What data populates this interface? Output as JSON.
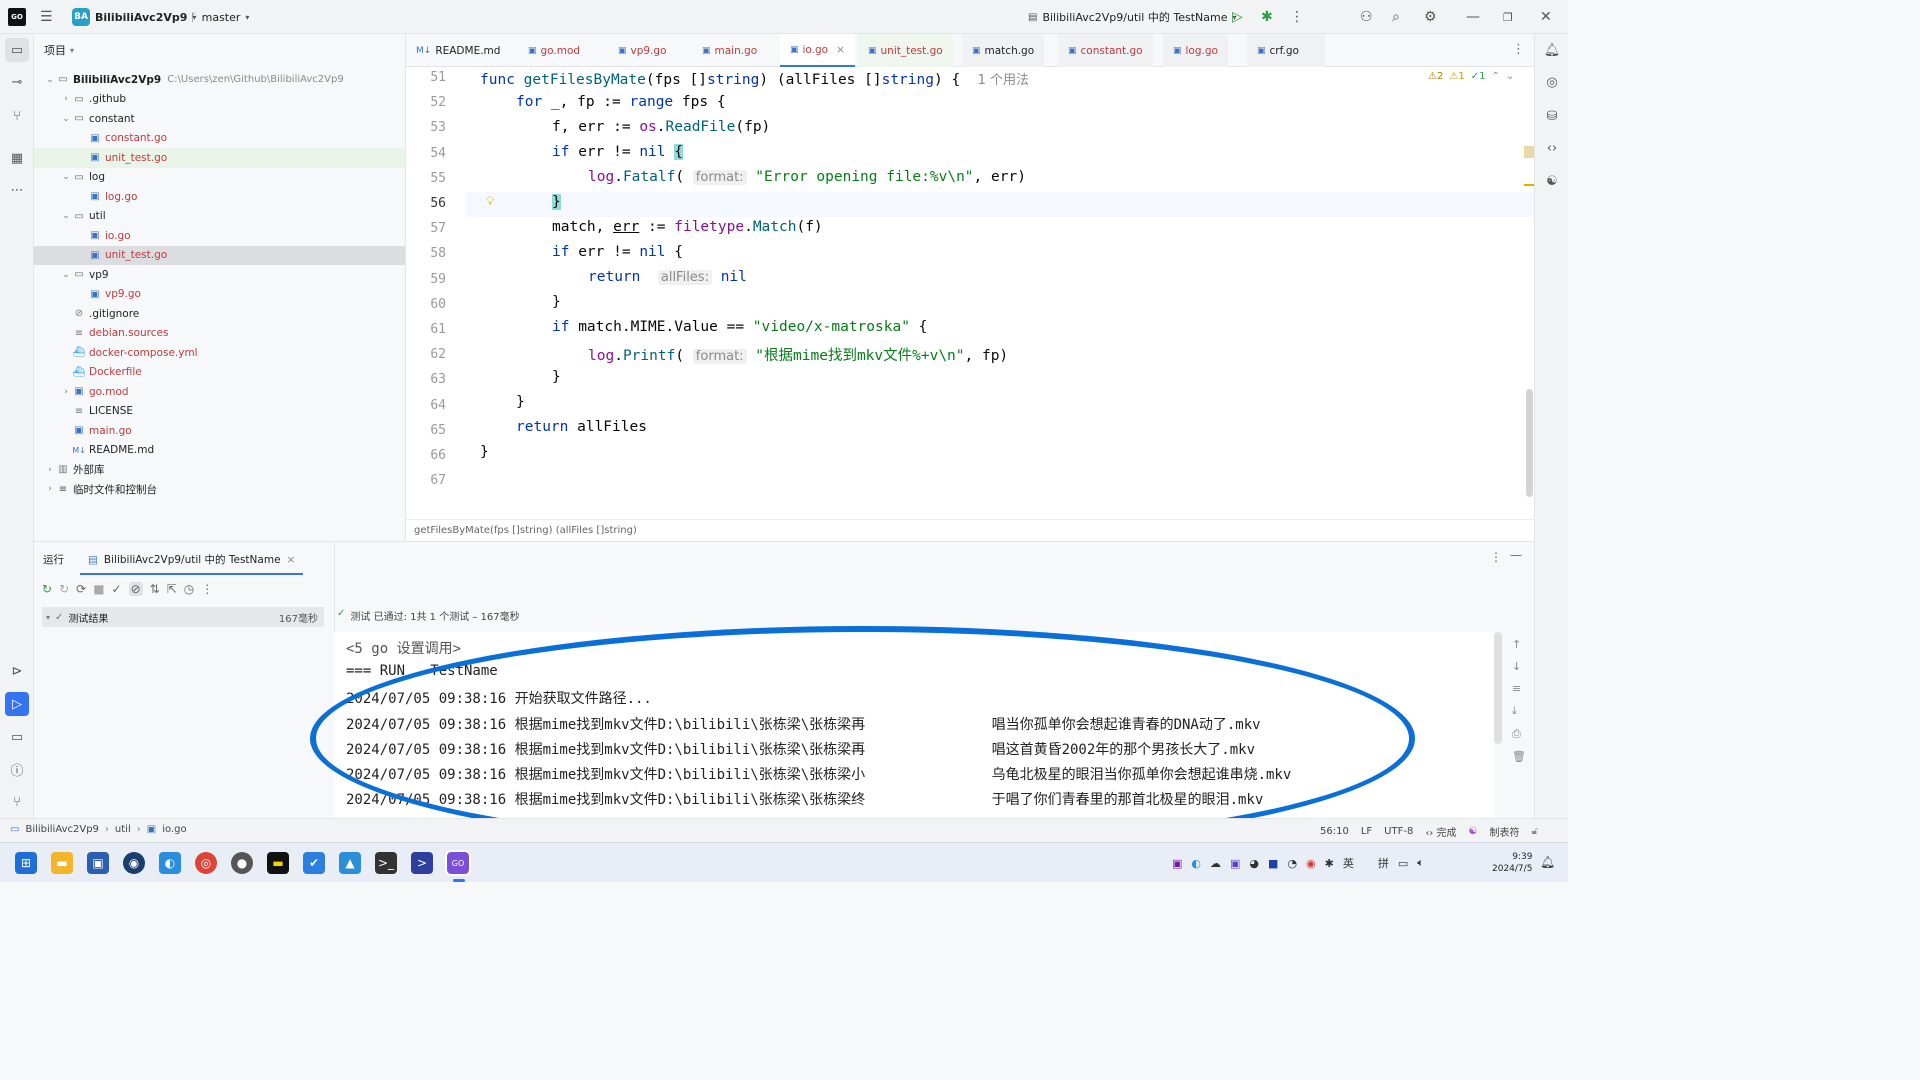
{
  "titlebar": {
    "logo": "GO",
    "project_badge": "BA",
    "project_name": "BilibiliAvc2Vp9",
    "branch": "master",
    "run_config": "BilibiliAvc2Vp9/util 中的 TestName"
  },
  "project_panel": {
    "title": "项目",
    "tree": [
      {
        "label": "BilibiliAvc2Vp9",
        "hint": "C:\\Users\\zen\\Github\\BilibiliAvc2Vp9",
        "depth": 0,
        "kind": "root",
        "expanded": true
      },
      {
        "label": ".github",
        "depth": 1,
        "kind": "folder",
        "expanded": false
      },
      {
        "label": "constant",
        "depth": 1,
        "kind": "folder",
        "expanded": true
      },
      {
        "label": "constant.go",
        "depth": 2,
        "kind": "go-red"
      },
      {
        "label": "unit_test.go",
        "depth": 2,
        "kind": "go-red",
        "highlight": "green"
      },
      {
        "label": "log",
        "depth": 1,
        "kind": "folder",
        "expanded": true
      },
      {
        "label": "log.go",
        "depth": 2,
        "kind": "go-red"
      },
      {
        "label": "util",
        "depth": 1,
        "kind": "folder",
        "expanded": true
      },
      {
        "label": "io.go",
        "depth": 2,
        "kind": "go-red"
      },
      {
        "label": "unit_test.go",
        "depth": 2,
        "kind": "go-red",
        "highlight": "selected"
      },
      {
        "label": "vp9",
        "depth": 1,
        "kind": "folder",
        "expanded": true
      },
      {
        "label": "vp9.go",
        "depth": 2,
        "kind": "go-red"
      },
      {
        "label": ".gitignore",
        "depth": 1,
        "kind": "ignore"
      },
      {
        "label": "debian.sources",
        "depth": 1,
        "kind": "text-red"
      },
      {
        "label": "docker-compose.yml",
        "depth": 1,
        "kind": "docker-red"
      },
      {
        "label": "Dockerfile",
        "depth": 1,
        "kind": "docker-red"
      },
      {
        "label": "go.mod",
        "depth": 1,
        "kind": "gomod-red",
        "collapsible": true
      },
      {
        "label": "LICENSE",
        "depth": 1,
        "kind": "text"
      },
      {
        "label": "main.go",
        "depth": 1,
        "kind": "go-red"
      },
      {
        "label": "README.md",
        "depth": 1,
        "kind": "md"
      },
      {
        "label": "外部库",
        "depth": 0,
        "kind": "lib",
        "collapsible": true
      },
      {
        "label": "临时文件和控制台",
        "depth": 0,
        "kind": "scratch",
        "collapsible": true
      }
    ]
  },
  "editor": {
    "tabs": [
      {
        "label": "README.md",
        "icon": "M↓"
      },
      {
        "label": "go.mod"
      },
      {
        "label": "vp9.go"
      },
      {
        "label": "main.go"
      },
      {
        "label": "io.go",
        "active": true
      },
      {
        "label": "unit_test.go"
      },
      {
        "label": "match.go"
      },
      {
        "label": "constant.go"
      },
      {
        "label": "log.go"
      },
      {
        "label": "crf.go"
      }
    ],
    "usage_hint": "1 个用法",
    "inspection": {
      "warn": "2",
      "weak": "1",
      "ok": "1"
    },
    "line_numbers": [
      "51",
      "52",
      "53",
      "54",
      "55",
      "56",
      "57",
      "58",
      "59",
      "60",
      "61",
      "62",
      "63",
      "64",
      "65",
      "66",
      "67"
    ],
    "inlay_format": "format:",
    "inlay_allfiles": "allFiles:",
    "breadcrumb": "getFilesByMate(fps []string) (allFiles []string)"
  },
  "run_panel": {
    "title": "运行",
    "tab": "BilibiliAvc2Vp9/util 中的 TestName",
    "tree_item": "测试结果",
    "tree_time": "167毫秒",
    "status": "测试 已通过: 1共 1 个测试 – 167毫秒",
    "console": [
      "<5 go 设置调用>",
      "=== RUN   TestName",
      "2024/07/05 09:38:16 开始获取文件路径...",
      "2024/07/05 09:38:16 根据mime找到mkv文件D:\\bilibili\\张栋梁\\张栋梁再               唱当你孤单你会想起谁青春的DNA动了.mkv",
      "2024/07/05 09:38:16 根据mime找到mkv文件D:\\bilibili\\张栋梁\\张栋梁再               唱这首黄昏2002年的那个男孩长大了.mkv",
      "2024/07/05 09:38:16 根据mime找到mkv文件D:\\bilibili\\张栋梁\\张栋梁小               乌龟北极星的眼泪当你孤单你会想起谁串烧.mkv",
      "2024/07/05 09:38:16 根据mime找到mkv文件D:\\bilibili\\张栋梁\\张栋梁终               于唱了你们青春里的那首北极星的眼泪.mkv"
    ]
  },
  "statusbar": {
    "crumbs": [
      "BilibiliAvc2Vp9",
      "util",
      "io.go"
    ],
    "position": "56:10",
    "line_sep": "LF",
    "encoding": "UTF-8",
    "vcs": "完成",
    "indent": "制表符"
  },
  "taskbar": {
    "ime1": "英",
    "ime2": "拼",
    "time": "9:39",
    "date": "2024/7/5"
  },
  "colors": {
    "accent": "#3574f0",
    "annotation": "#0a6fd8",
    "keyword": "#0033b3",
    "string": "#067d17",
    "function": "#00627a",
    "package": "#871094"
  }
}
